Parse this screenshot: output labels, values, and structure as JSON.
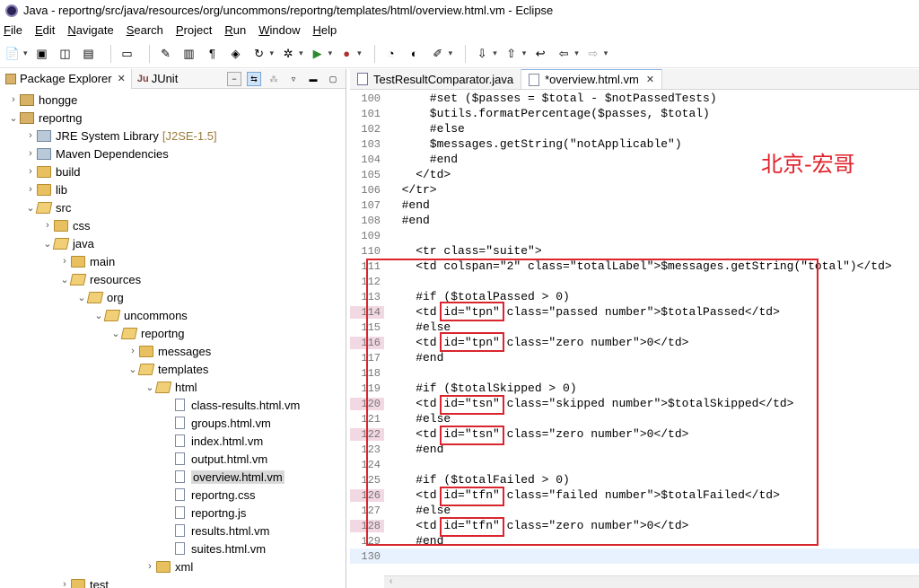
{
  "window": {
    "title": "Java - reportng/src/java/resources/org/uncommons/reportng/templates/html/overview.html.vm - Eclipse"
  },
  "menu": [
    "File",
    "Edit",
    "Navigate",
    "Search",
    "Project",
    "Run",
    "Window",
    "Help"
  ],
  "left_panel": {
    "tabs": [
      {
        "label": "Package Explorer",
        "close": "✕"
      },
      {
        "label": "JUnit",
        "prefix": "Ju"
      }
    ],
    "tree": [
      {
        "label": "hongge",
        "depth": 0,
        "twisty": "›",
        "icon": "project"
      },
      {
        "label": "reportng",
        "depth": 0,
        "twisty": "⌄",
        "icon": "project"
      },
      {
        "label": "JRE System Library",
        "note": "[J2SE-1.5]",
        "depth": 1,
        "twisty": "›",
        "icon": "lib"
      },
      {
        "label": "Maven Dependencies",
        "depth": 1,
        "twisty": "›",
        "icon": "lib"
      },
      {
        "label": "build",
        "depth": 1,
        "twisty": "›",
        "icon": "folder"
      },
      {
        "label": "lib",
        "depth": 1,
        "twisty": "›",
        "icon": "folder"
      },
      {
        "label": "src",
        "depth": 1,
        "twisty": "⌄",
        "icon": "folder-open"
      },
      {
        "label": "css",
        "depth": 2,
        "twisty": "›",
        "icon": "folder"
      },
      {
        "label": "java",
        "depth": 2,
        "twisty": "⌄",
        "icon": "folder-open"
      },
      {
        "label": "main",
        "depth": 3,
        "twisty": "›",
        "icon": "folder"
      },
      {
        "label": "resources",
        "depth": 3,
        "twisty": "⌄",
        "icon": "folder-open"
      },
      {
        "label": "org",
        "depth": 4,
        "twisty": "⌄",
        "icon": "folder-open"
      },
      {
        "label": "uncommons",
        "depth": 5,
        "twisty": "⌄",
        "icon": "folder-open"
      },
      {
        "label": "reportng",
        "depth": 6,
        "twisty": "⌄",
        "icon": "folder-open"
      },
      {
        "label": "messages",
        "depth": 7,
        "twisty": "›",
        "icon": "folder"
      },
      {
        "label": "templates",
        "depth": 7,
        "twisty": "⌄",
        "icon": "folder-open"
      },
      {
        "label": "html",
        "depth": 8,
        "twisty": "⌄",
        "icon": "folder-open"
      },
      {
        "label": "class-results.html.vm",
        "depth": 9,
        "twisty": "",
        "icon": "file"
      },
      {
        "label": "groups.html.vm",
        "depth": 9,
        "twisty": "",
        "icon": "file"
      },
      {
        "label": "index.html.vm",
        "depth": 9,
        "twisty": "",
        "icon": "file"
      },
      {
        "label": "output.html.vm",
        "depth": 9,
        "twisty": "",
        "icon": "file"
      },
      {
        "label": "overview.html.vm",
        "depth": 9,
        "twisty": "",
        "icon": "file",
        "selected": true
      },
      {
        "label": "reportng.css",
        "depth": 9,
        "twisty": "",
        "icon": "file"
      },
      {
        "label": "reportng.js",
        "depth": 9,
        "twisty": "",
        "icon": "file"
      },
      {
        "label": "results.html.vm",
        "depth": 9,
        "twisty": "",
        "icon": "file"
      },
      {
        "label": "suites.html.vm",
        "depth": 9,
        "twisty": "",
        "icon": "file"
      },
      {
        "label": "xml",
        "depth": 8,
        "twisty": "›",
        "icon": "folder"
      },
      {
        "label": "test",
        "depth": 3,
        "twisty": "›",
        "icon": "folder"
      }
    ]
  },
  "editor": {
    "tabs": [
      {
        "label": "TestResultComparator.java",
        "active": false
      },
      {
        "label": "*overview.html.vm",
        "active": true,
        "close": "✕"
      }
    ],
    "watermark": "北京-宏哥",
    "lines": [
      {
        "n": "100",
        "t": "      #set ($passes = $total - $notPassedTests)"
      },
      {
        "n": "101",
        "t": "      $utils.formatPercentage($passes, $total)"
      },
      {
        "n": "102",
        "t": "      #else"
      },
      {
        "n": "103",
        "t": "      $messages.getString(\"notApplicable\")"
      },
      {
        "n": "104",
        "t": "      #end"
      },
      {
        "n": "105",
        "t": "    </td>"
      },
      {
        "n": "106",
        "t": "  </tr>"
      },
      {
        "n": "107",
        "t": "  #end"
      },
      {
        "n": "108",
        "t": "  #end"
      },
      {
        "n": "109",
        "t": ""
      },
      {
        "n": "110",
        "t": "    <tr class=\"suite\">"
      },
      {
        "n": "111",
        "t": "    <td colspan=\"2\" class=\"totalLabel\">$messages.getString(\"total\")</td>"
      },
      {
        "n": "112",
        "t": ""
      },
      {
        "n": "113",
        "t": "    #if ($totalPassed > 0)"
      },
      {
        "n": "114",
        "t": "    <td id=\"tpn\" class=\"passed number\">$totalPassed</td>",
        "mark": true
      },
      {
        "n": "115",
        "t": "    #else"
      },
      {
        "n": "116",
        "t": "    <td id=\"tpn\" class=\"zero number\">0</td>",
        "mark": true
      },
      {
        "n": "117",
        "t": "    #end"
      },
      {
        "n": "118",
        "t": ""
      },
      {
        "n": "119",
        "t": "    #if ($totalSkipped > 0)"
      },
      {
        "n": "120",
        "t": "    <td id=\"tsn\" class=\"skipped number\">$totalSkipped</td>",
        "mark": true
      },
      {
        "n": "121",
        "t": "    #else"
      },
      {
        "n": "122",
        "t": "    <td id=\"tsn\" class=\"zero number\">0</td>",
        "mark": true
      },
      {
        "n": "123",
        "t": "    #end"
      },
      {
        "n": "124",
        "t": ""
      },
      {
        "n": "125",
        "t": "    #if ($totalFailed > 0)"
      },
      {
        "n": "126",
        "t": "    <td id=\"tfn\" class=\"failed number\">$totalFailed</td>",
        "mark": true
      },
      {
        "n": "127",
        "t": "    #else"
      },
      {
        "n": "128",
        "t": "    <td id=\"tfn\" class=\"zero number\">0</td>",
        "mark": true
      },
      {
        "n": "129",
        "t": "    #end"
      },
      {
        "n": "130",
        "t": "",
        "current": true
      }
    ]
  }
}
